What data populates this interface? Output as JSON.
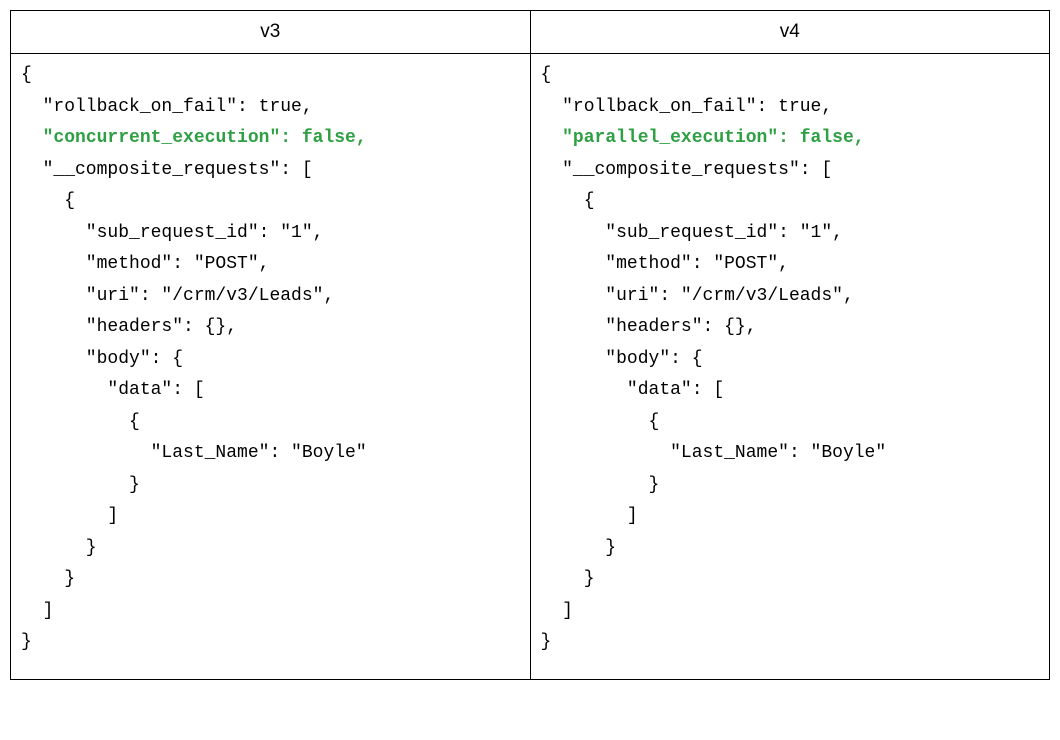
{
  "table": {
    "headers": {
      "left": "v3",
      "right": "v4"
    },
    "left": {
      "lines": [
        "{",
        "  \"rollback_on_fail\": true,",
        "  \"concurrent_execution\": false,",
        "  \"__composite_requests\": [",
        "    {",
        "      \"sub_request_id\": \"1\",",
        "      \"method\": \"POST\",",
        "      \"uri\": \"/crm/v3/Leads\",",
        "      \"headers\": {},",
        "      \"body\": {",
        "        \"data\": [",
        "          {",
        "            \"Last_Name\": \"Boyle\"",
        "          }",
        "        ]",
        "      }",
        "    }",
        "  ]",
        "}"
      ],
      "highlight_line_index": 2
    },
    "right": {
      "lines": [
        "{",
        "  \"rollback_on_fail\": true,",
        "  \"parallel_execution\": false,",
        "  \"__composite_requests\": [",
        "    {",
        "      \"sub_request_id\": \"1\",",
        "      \"method\": \"POST\",",
        "      \"uri\": \"/crm/v3/Leads\",",
        "      \"headers\": {},",
        "      \"body\": {",
        "        \"data\": [",
        "          {",
        "            \"Last_Name\": \"Boyle\"",
        "          }",
        "        ]",
        "      }",
        "    }",
        "  ]",
        "}"
      ],
      "highlight_line_index": 2
    }
  }
}
